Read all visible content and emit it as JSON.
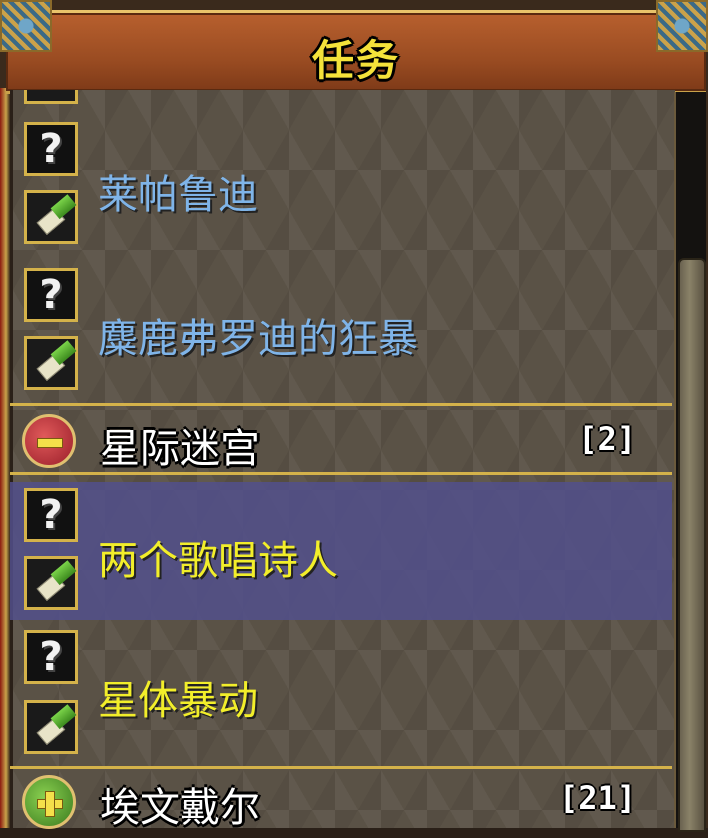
{
  "window": {
    "title": "任务"
  },
  "quests_above": [
    {
      "name": "莱帕鲁迪",
      "color": "#7fb4e8",
      "icon_top": "question-mark-icon",
      "icon_bottom": "scroll-icon"
    },
    {
      "name": "麋鹿弗罗迪的狂暴",
      "color": "#7fb4e8",
      "icon_top": "question-mark-icon",
      "icon_bottom": "scroll-icon"
    }
  ],
  "category_1": {
    "name": "星际迷宫",
    "count": "[2]",
    "state": "collapse",
    "icon": "minus-icon"
  },
  "quests_cat1": [
    {
      "name": "两个歌唱诗人",
      "color": "#f2ee2a",
      "selected": true,
      "icon_top": "question-mark-icon",
      "icon_bottom": "scroll-icon"
    },
    {
      "name": "星体暴动",
      "color": "#f2ee2a",
      "selected": false,
      "icon_top": "question-mark-icon",
      "icon_bottom": "scroll-icon"
    }
  ],
  "category_2": {
    "name": "埃文戴尔",
    "count": "[21]",
    "state": "expand",
    "icon": "plus-icon"
  },
  "icon_glyphs": {
    "question": "?"
  }
}
